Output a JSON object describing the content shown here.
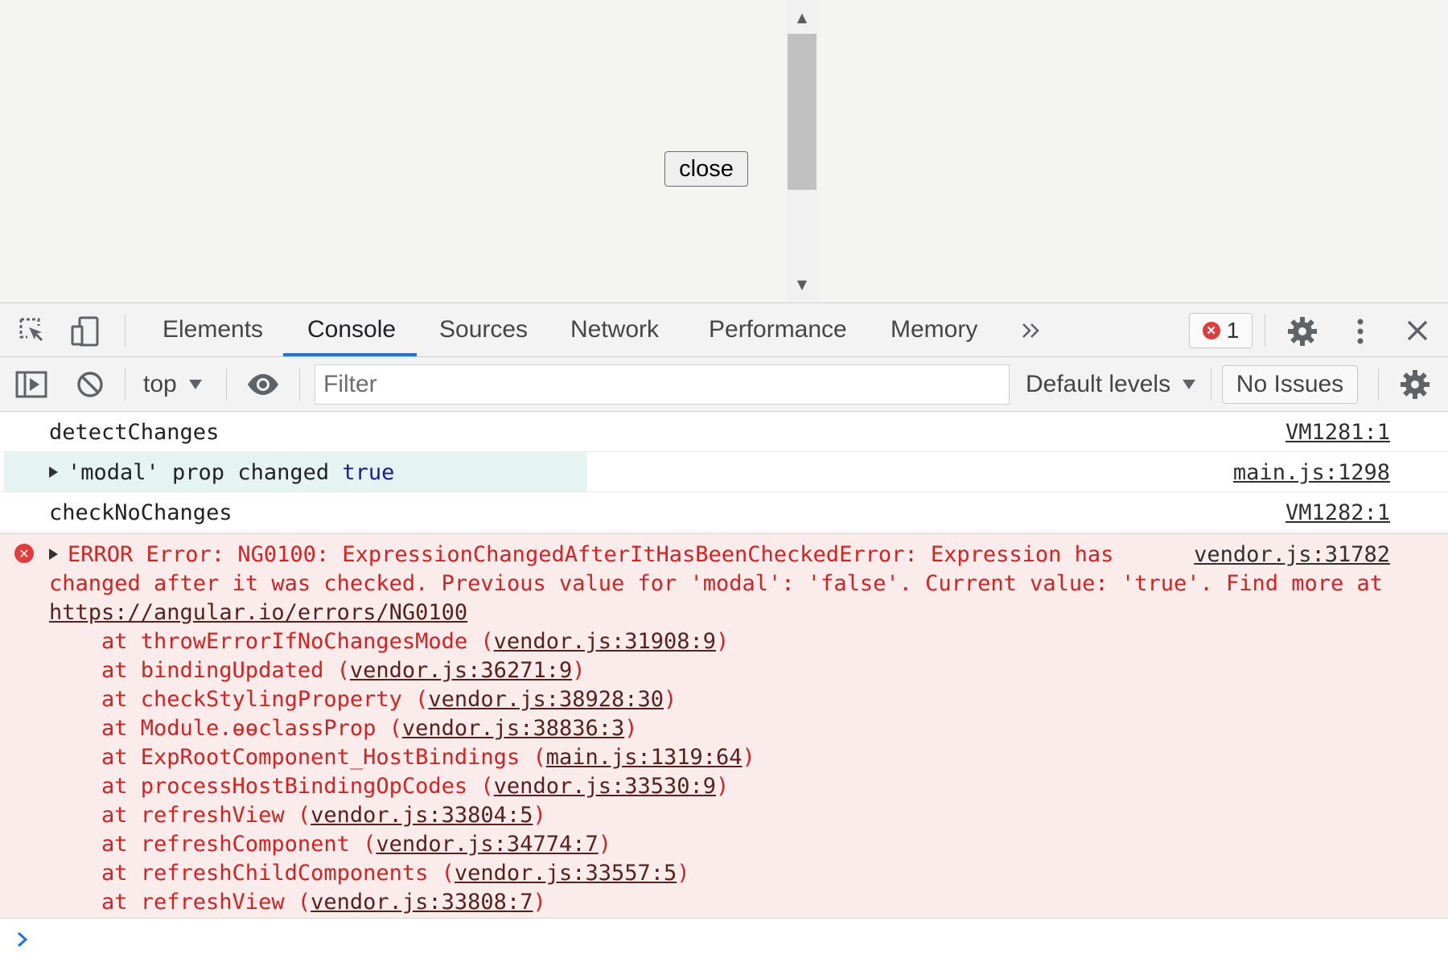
{
  "page": {
    "close_button": "close"
  },
  "devtools": {
    "tabs": [
      {
        "label": "Elements"
      },
      {
        "label": "Console",
        "active": true
      },
      {
        "label": "Sources"
      },
      {
        "label": "Network"
      },
      {
        "label": "Performance"
      },
      {
        "label": "Memory"
      }
    ],
    "more_tabs_icon": "chevron-double-right-icon",
    "error_count": "1",
    "accent_color": "#1a73e8",
    "error_color": "#e23b3b"
  },
  "toolbar": {
    "context": "top",
    "filter_placeholder": "Filter",
    "levels": "Default levels",
    "issues": "No Issues"
  },
  "console": {
    "messages": [
      {
        "text": "detectChanges",
        "source": "VM1281:1"
      },
      {
        "text_before": "'modal' prop changed ",
        "value": "true",
        "source": "main.js:1298"
      },
      {
        "text": "checkNoChanges",
        "source": "VM1282:1"
      }
    ],
    "error": {
      "line1": "ERROR Error: NG0100: ExpressionChangedAfterItHasBeenCheckedError: Expression has",
      "source": "vendor.js:31782",
      "line2": "changed after it was checked. Previous value for 'modal': 'false'. Current value: 'true'. Find more at",
      "url": "https://angular.io/errors/NG0100",
      "stack": [
        {
          "fn": "at throwErrorIfNoChangesMode ",
          "loc": "vendor.js:31908:9"
        },
        {
          "fn": "at bindingUpdated ",
          "loc": "vendor.js:36271:9"
        },
        {
          "fn": "at checkStylingProperty ",
          "loc": "vendor.js:38928:30"
        },
        {
          "fn": "at Module.ɵɵclassProp ",
          "loc": "vendor.js:38836:3"
        },
        {
          "fn": "at ExpRootComponent_HostBindings ",
          "loc": "main.js:1319:64"
        },
        {
          "fn": "at processHostBindingOpCodes ",
          "loc": "vendor.js:33530:9"
        },
        {
          "fn": "at refreshView ",
          "loc": "vendor.js:33804:5"
        },
        {
          "fn": "at refreshComponent ",
          "loc": "vendor.js:34774:7"
        },
        {
          "fn": "at refreshChildComponents ",
          "loc": "vendor.js:33557:5"
        },
        {
          "fn": "at refreshView ",
          "loc": "vendor.js:33808:7"
        }
      ]
    }
  }
}
